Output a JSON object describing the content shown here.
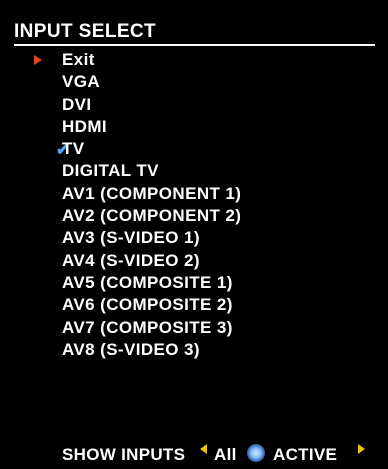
{
  "osd": {
    "title": "INPUT SELECT",
    "items": [
      {
        "label": "Exit",
        "marker": "selected-arrow-icon"
      },
      {
        "label": "VGA",
        "marker": ""
      },
      {
        "label": "DVI",
        "marker": ""
      },
      {
        "label": "HDMI",
        "marker": ""
      },
      {
        "label": "TV",
        "marker": "check-icon"
      },
      {
        "label": "DIGITAL TV",
        "marker": ""
      },
      {
        "label": "AV1 (COMPONENT 1)",
        "marker": ""
      },
      {
        "label": "AV2 (COMPONENT 2)",
        "marker": ""
      },
      {
        "label": "AV3 (S-VIDEO 1)",
        "marker": ""
      },
      {
        "label": "AV4 (S-VIDEO 2)",
        "marker": ""
      },
      {
        "label": "AV5 (COMPOSITE 1)",
        "marker": ""
      },
      {
        "label": "AV6 (COMPOSITE 2)",
        "marker": ""
      },
      {
        "label": "AV7 (COMPOSITE 3)",
        "marker": ""
      },
      {
        "label": "AV8 (S-VIDEO 3)",
        "marker": ""
      }
    ],
    "show_inputs": {
      "label": "SHOW INPUTS",
      "left_option": "All",
      "right_option": "ACTIVE"
    },
    "colors": {
      "selection_arrow": "#e8402a",
      "check": "#4aa7ff",
      "toggle_arrows": "#f2c200",
      "background": "#000000",
      "text": "#ffffff"
    }
  }
}
